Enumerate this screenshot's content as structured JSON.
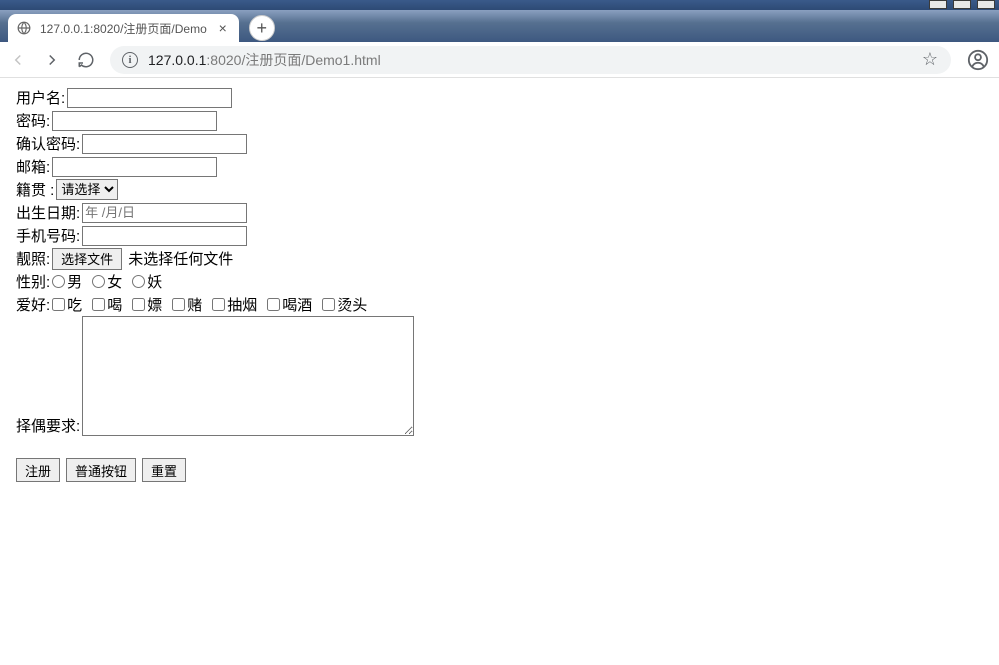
{
  "browser": {
    "tab_title": "127.0.0.1:8020/注册页面/Demo",
    "url_host": "127.0.0.1",
    "url_port": ":8020",
    "url_path": "/注册页面/Demo1.html"
  },
  "form": {
    "username_label": "用户名:",
    "password_label": "密码:",
    "confirm_label": "确认密码:",
    "email_label": "邮箱:",
    "origin_label": "籍贯 :",
    "origin_select_placeholder": "请选择",
    "birth_label": "出生日期:",
    "birth_placeholder": "年 /月/日",
    "phone_label": "手机号码:",
    "photo_label": "靓照:",
    "file_button": "选择文件",
    "file_status": "未选择任何文件",
    "gender_label": "性别:",
    "gender_options": [
      "男",
      "女",
      "妖"
    ],
    "hobby_label": "爱好:",
    "hobby_options": [
      "吃",
      "喝",
      "嫖",
      "赌",
      "抽烟",
      "喝酒",
      "烫头"
    ],
    "mate_label": "择偶要求:",
    "submit_button": "注册",
    "normal_button": "普通按钮",
    "reset_button": "重置"
  }
}
